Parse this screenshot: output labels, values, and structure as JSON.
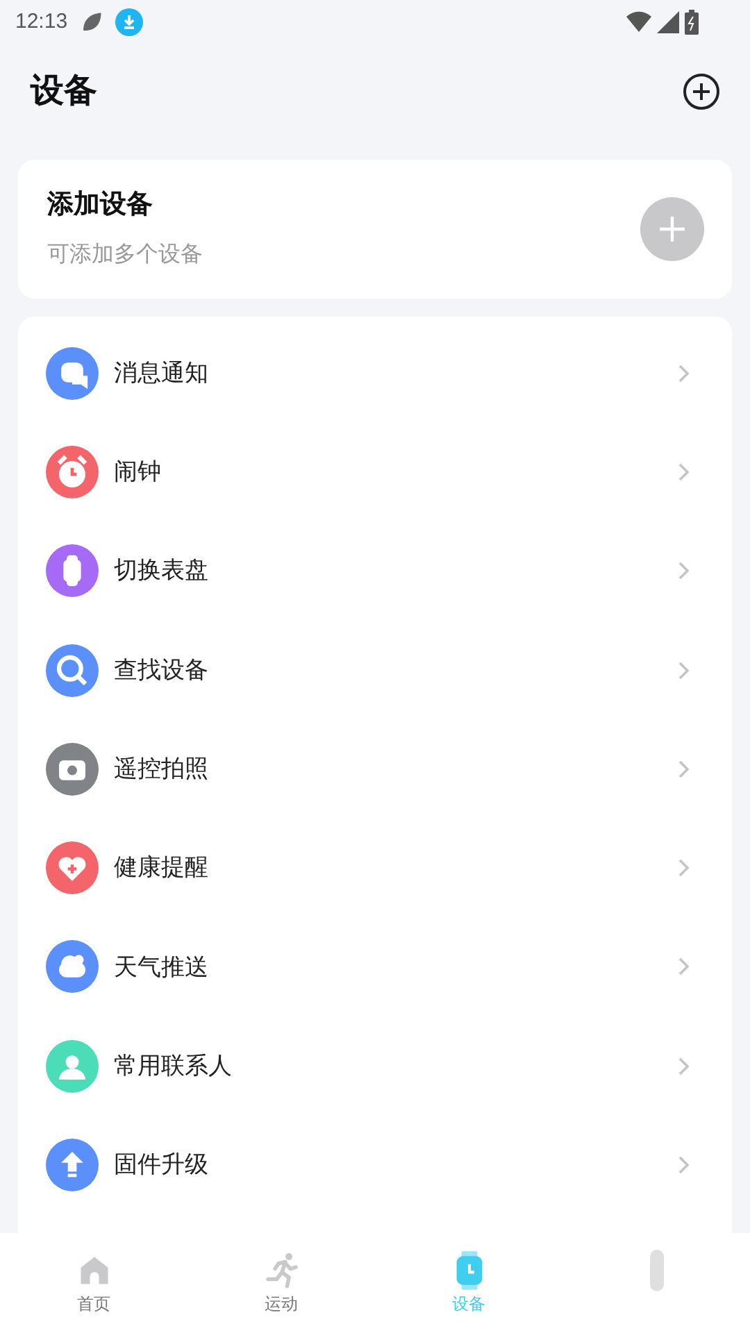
{
  "status_bar": {
    "time": "12:13"
  },
  "header": {
    "title": "设备"
  },
  "add_card": {
    "title": "添加设备",
    "subtitle": "可添加多个设备"
  },
  "menu": [
    {
      "kind": "message",
      "label": "消息通知",
      "color": "#5b8ff9"
    },
    {
      "kind": "alarm",
      "label": "闹钟",
      "color": "#f4656b"
    },
    {
      "kind": "watch",
      "label": "切换表盘",
      "color": "#a56bf6"
    },
    {
      "kind": "search",
      "label": "查找设备",
      "color": "#5b8ff9"
    },
    {
      "kind": "camera",
      "label": "遥控拍照",
      "color": "#808387"
    },
    {
      "kind": "health",
      "label": "健康提醒",
      "color": "#f4656b"
    },
    {
      "kind": "weather",
      "label": "天气推送",
      "color": "#5b8ff9"
    },
    {
      "kind": "contact",
      "label": "常用联系人",
      "color": "#4bdcb8"
    },
    {
      "kind": "upgrade",
      "label": "固件升级",
      "color": "#5b8ff9"
    }
  ],
  "tabs": [
    {
      "kind": "home",
      "label": "首页",
      "selected": false
    },
    {
      "kind": "sport",
      "label": "运动",
      "selected": false
    },
    {
      "kind": "device",
      "label": "设备",
      "selected": true
    },
    {
      "kind": "profile",
      "selected": false
    }
  ]
}
